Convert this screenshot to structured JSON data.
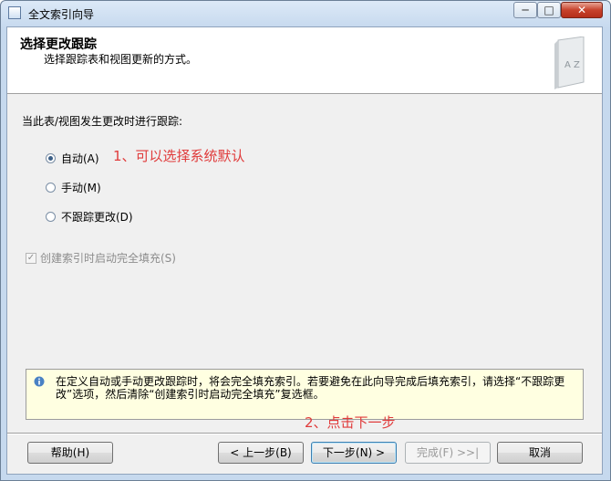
{
  "window": {
    "title": "全文索引向导",
    "min_glyph": "─",
    "max_glyph": "□",
    "close_glyph": "✕"
  },
  "header": {
    "title": "选择更改跟踪",
    "subtitle": "选择跟踪表和视图更新的方式。",
    "logo_text": "A Z"
  },
  "prompt": "当此表/视图发生更改时进行跟踪:",
  "options": [
    {
      "label": "自动(A)",
      "checked": true
    },
    {
      "label": "手动(M)",
      "checked": false
    },
    {
      "label": "不跟踪更改(D)",
      "checked": false
    }
  ],
  "annotation1": "1、可以选择系统默认",
  "checkbox": {
    "label": "创建索引时启动完全填充(S)",
    "checked": true,
    "enabled": false
  },
  "info": "在定义自动或手动更改跟踪时，将会完全填充索引。若要避免在此向导完成后填充索引，请选择“不跟踪更改”选项，然后清除“创建索引时启动完全填充”复选框。",
  "annotation2": "2、点击下一步",
  "buttons": {
    "help": "帮助(H)",
    "back": "< 上一步(B)",
    "next": "下一步(N) >",
    "finish": "完成(F) >>|",
    "cancel": "取消"
  }
}
